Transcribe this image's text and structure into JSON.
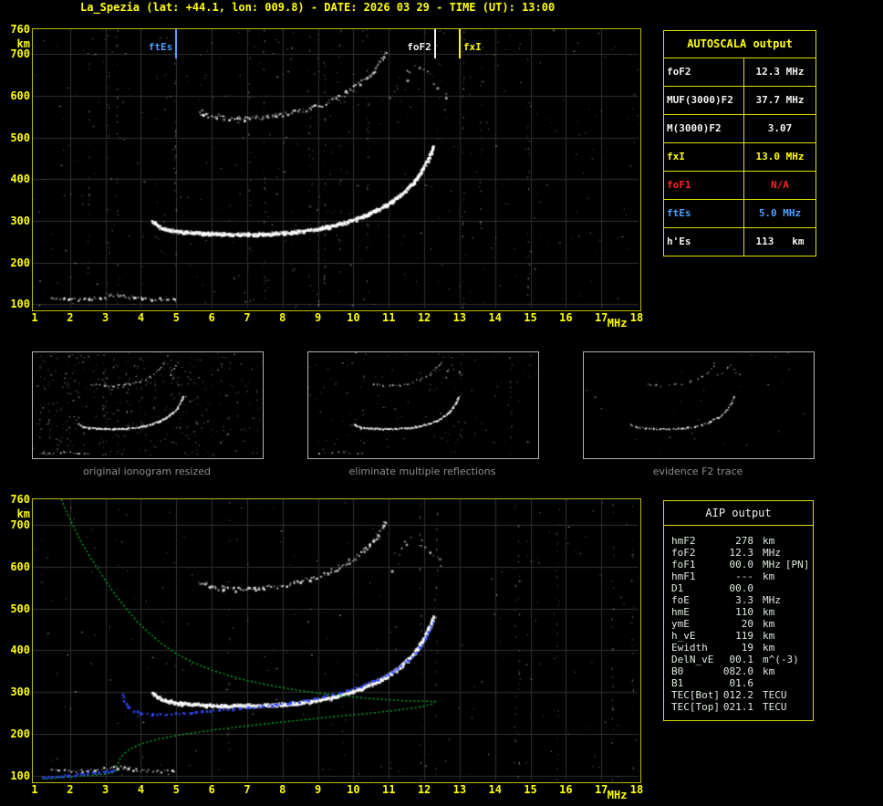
{
  "title": "La_Spezia (lat: +44.1, lon: 009.8) - DATE: 2026 03 29 - TIME (UT): 13:00",
  "axis": {
    "x_unit": "MHz",
    "y_unit": "km"
  },
  "colors": {
    "background": "#000000",
    "title_yellow": "#ffff00",
    "plot_border": "#b9b900",
    "grid": "#323232",
    "axis_label": "#ffff00",
    "echo_white": "#ffffff",
    "profile_green": "#00b428",
    "trace_blue": "#2f49ff",
    "value_white": "#f2f2f2",
    "value_red": "#ff2222",
    "value_blue": "#4f9fff",
    "accent_yellow": "#ffff00",
    "panel_border": "#b4b4b4",
    "caption_gray": "#8f8f8f",
    "table_border": "#dede00",
    "aip_text": "#dfeadf"
  },
  "autoscala": {
    "header": "AUTOSCALA output",
    "rows": [
      {
        "label": "foF2",
        "value": "12.3 MHz",
        "color_key": "value_white"
      },
      {
        "label": "MUF(3000)F2",
        "value": "37.7 MHz",
        "color_key": "value_white"
      },
      {
        "label": "M(3000)F2",
        "value": "3.07",
        "color_key": "value_white"
      },
      {
        "label": "fxI",
        "value": "13.0 MHz",
        "color_key": "accent_yellow"
      },
      {
        "label": "foF1",
        "value": "N/A",
        "color_key": "value_red"
      },
      {
        "label": "ftEs",
        "value": "5.0 MHz",
        "color_key": "value_blue"
      },
      {
        "label": "h'Es",
        "value": "113   km",
        "color_key": "value_white"
      }
    ]
  },
  "panels": [
    {
      "caption": "original ionogram resized"
    },
    {
      "caption": "eliminate multiple reflections"
    },
    {
      "caption": "evidence F2 trace"
    }
  ],
  "aip": {
    "header": "AIP output",
    "rows": [
      {
        "label": "hmF2",
        "value": "278",
        "unit": "km",
        "note": ""
      },
      {
        "label": "foF2",
        "value": "12.3",
        "unit": "MHz",
        "note": ""
      },
      {
        "label": "foF1",
        "value": "00.0",
        "unit": "MHz",
        "note": "[PN]"
      },
      {
        "label": "hmF1",
        "value": "---",
        "unit": "km",
        "note": ""
      },
      {
        "label": "D1",
        "value": "00.0",
        "unit": "",
        "note": ""
      },
      {
        "label": "foE",
        "value": "3.3",
        "unit": "MHz",
        "note": ""
      },
      {
        "label": "hmE",
        "value": "110",
        "unit": "km",
        "note": ""
      },
      {
        "label": "ymE",
        "value": "20",
        "unit": "km",
        "note": ""
      },
      {
        "label": "h_vE",
        "value": "119",
        "unit": "km",
        "note": ""
      },
      {
        "label": "Ewidth",
        "value": "19",
        "unit": "km",
        "note": ""
      },
      {
        "label": "DelN_vE",
        "value": "00.1",
        "unit": "m^(-3)",
        "note": ""
      },
      {
        "label": "B0",
        "value": "082.0",
        "unit": "km",
        "note": ""
      },
      {
        "label": "B1",
        "value": "01.6",
        "unit": "",
        "note": ""
      },
      {
        "label": "TEC[Bot]",
        "value": "012.2",
        "unit": "TECU",
        "note": ""
      },
      {
        "label": "TEC[Top]",
        "value": "021.1",
        "unit": "TECU",
        "note": ""
      }
    ]
  },
  "chart_data": {
    "type": "scatter",
    "title": "Ionogram echoes with AUTOSCALA interpretation and restored electron density profile",
    "xlabel": "MHz",
    "ylabel": "km",
    "xlim": [
      1,
      18
    ],
    "ylim": [
      90,
      760
    ],
    "x_ticks": [
      1,
      2,
      3,
      4,
      5,
      6,
      7,
      8,
      9,
      10,
      11,
      12,
      13,
      14,
      15,
      16,
      17,
      18
    ],
    "y_tick_labels": [
      760,
      700,
      600,
      500,
      400,
      300,
      200,
      100
    ],
    "grid": true,
    "markers": [
      {
        "name": "ftEs",
        "freq": 5.0,
        "color_key": "value_blue",
        "side": "left"
      },
      {
        "name": "foF2",
        "freq": 12.3,
        "color_key": "value_white",
        "side": "left"
      },
      {
        "name": "fxI",
        "freq": 13.0,
        "color_key": "accent_yellow",
        "side": "right"
      }
    ],
    "echo_traces": {
      "es": [
        [
          1.4,
          116
        ],
        [
          1.9,
          114
        ],
        [
          2.4,
          114
        ],
        [
          2.9,
          118
        ],
        [
          3.2,
          124
        ],
        [
          3.5,
          122
        ],
        [
          3.8,
          117
        ],
        [
          4.2,
          115
        ],
        [
          4.6,
          114
        ],
        [
          5.0,
          113
        ]
      ],
      "f2": [
        [
          4.3,
          302
        ],
        [
          4.45,
          290
        ],
        [
          4.7,
          281
        ],
        [
          5.0,
          276
        ],
        [
          5.5,
          273
        ],
        [
          6.0,
          271
        ],
        [
          6.5,
          270
        ],
        [
          7.0,
          270
        ],
        [
          7.5,
          271
        ],
        [
          8.0,
          273
        ],
        [
          8.5,
          277
        ],
        [
          9.0,
          283
        ],
        [
          9.4,
          290
        ],
        [
          9.8,
          299
        ],
        [
          10.1,
          308
        ],
        [
          10.4,
          318
        ],
        [
          10.7,
          330
        ],
        [
          11.0,
          344
        ],
        [
          11.25,
          360
        ],
        [
          11.5,
          378
        ],
        [
          11.7,
          396
        ],
        [
          11.85,
          414
        ],
        [
          12.0,
          434
        ],
        [
          12.1,
          452
        ],
        [
          12.18,
          468
        ],
        [
          12.24,
          482
        ]
      ],
      "second_hop": [
        [
          5.6,
          565
        ],
        [
          5.9,
          556
        ],
        [
          6.2,
          551
        ],
        [
          6.6,
          548
        ],
        [
          7.0,
          548
        ],
        [
          7.4,
          550
        ],
        [
          7.8,
          554
        ],
        [
          8.2,
          560
        ],
        [
          8.6,
          568
        ],
        [
          9.0,
          578
        ],
        [
          9.3,
          588
        ],
        [
          9.6,
          600
        ],
        [
          9.9,
          614
        ],
        [
          10.15,
          630
        ],
        [
          10.4,
          648
        ],
        [
          10.6,
          668
        ],
        [
          10.75,
          688
        ],
        [
          10.9,
          710
        ]
      ],
      "high_scatter": [
        [
          11.0,
          600
        ],
        [
          11.2,
          625
        ],
        [
          11.4,
          645
        ],
        [
          11.6,
          662
        ],
        [
          11.8,
          674
        ],
        [
          12.0,
          658
        ],
        [
          12.2,
          636
        ],
        [
          12.45,
          612
        ],
        [
          12.65,
          596
        ]
      ]
    },
    "profile": [
      [
        1.75,
        760
      ],
      [
        1.9,
        730
      ],
      [
        2.1,
        695
      ],
      [
        2.3,
        660
      ],
      [
        2.55,
        625
      ],
      [
        2.8,
        592
      ],
      [
        3.05,
        560
      ],
      [
        3.3,
        530
      ],
      [
        3.6,
        498
      ],
      [
        3.9,
        468
      ],
      [
        4.25,
        440
      ],
      [
        4.6,
        415
      ],
      [
        5.0,
        392
      ],
      [
        5.5,
        370
      ],
      [
        6.1,
        350
      ],
      [
        6.8,
        332
      ],
      [
        7.6,
        317
      ],
      [
        8.5,
        304
      ],
      [
        9.5,
        293
      ],
      [
        10.5,
        285
      ],
      [
        11.4,
        280
      ],
      [
        12.0,
        279
      ],
      [
        12.3,
        278
      ],
      [
        12.2,
        271
      ],
      [
        11.8,
        264
      ],
      [
        11.1,
        256
      ],
      [
        10.2,
        248
      ],
      [
        9.2,
        240
      ],
      [
        8.2,
        231
      ],
      [
        7.2,
        222
      ],
      [
        6.2,
        212
      ],
      [
        5.3,
        201
      ],
      [
        4.5,
        189
      ],
      [
        4.0,
        177
      ],
      [
        3.7,
        165
      ],
      [
        3.5,
        152
      ],
      [
        3.4,
        140
      ],
      [
        3.35,
        128
      ],
      [
        3.3,
        118
      ],
      [
        3.3,
        112
      ],
      [
        3.2,
        108
      ],
      [
        3.0,
        105
      ],
      [
        2.6,
        102
      ],
      [
        2.1,
        99
      ],
      [
        1.6,
        96
      ],
      [
        1.15,
        93
      ]
    ],
    "restored_trace_f": [
      [
        3.45,
        300
      ],
      [
        3.48,
        288
      ],
      [
        3.55,
        276
      ],
      [
        3.65,
        265
      ],
      [
        3.8,
        257
      ],
      [
        4.0,
        252
      ],
      [
        4.3,
        250
      ],
      [
        4.7,
        250
      ],
      [
        5.1,
        252
      ],
      [
        5.6,
        255
      ],
      [
        6.1,
        258
      ],
      [
        6.6,
        262
      ],
      [
        7.1,
        266
      ],
      [
        7.6,
        271
      ],
      [
        8.1,
        276
      ],
      [
        8.6,
        282
      ],
      [
        9.0,
        289
      ],
      [
        9.4,
        297
      ],
      [
        9.8,
        306
      ],
      [
        10.2,
        317
      ],
      [
        10.6,
        330
      ],
      [
        11.0,
        346
      ],
      [
        11.3,
        363
      ],
      [
        11.6,
        383
      ],
      [
        11.8,
        402
      ],
      [
        11.95,
        421
      ],
      [
        12.08,
        441
      ],
      [
        12.17,
        459
      ],
      [
        12.23,
        475
      ]
    ],
    "restored_trace_e": [
      [
        1.15,
        99
      ],
      [
        1.5,
        101
      ],
      [
        1.85,
        103
      ],
      [
        2.2,
        106
      ],
      [
        2.55,
        109
      ],
      [
        2.85,
        112
      ],
      [
        3.1,
        115
      ],
      [
        3.28,
        118
      ]
    ]
  }
}
